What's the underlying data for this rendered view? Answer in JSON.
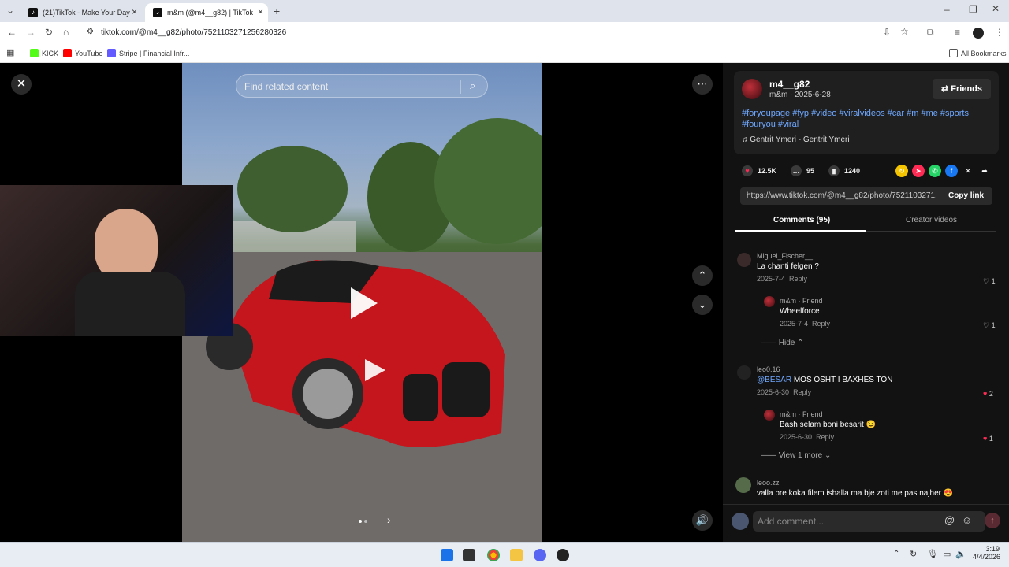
{
  "tabs": [
    {
      "title": "(21)TikTok - Make Your Day"
    },
    {
      "title": "m&m (@m4__g82) | TikTok"
    }
  ],
  "url": "tiktok.com/@m4__g82/photo/7521103271256280326",
  "bookmarks": [
    "KICK",
    "YouTube",
    "Stripe | Financial Infr...",
    "All Bookmarks"
  ],
  "search_placeholder": "Find related content",
  "author": {
    "username": "m4__g82",
    "meta": "m&m · 2025-6-28",
    "follow_button": "Friends",
    "caption": "#foryoupage #fyp #video #viralvideos #car #m #me #sports #fouryou #viral",
    "music": "Gentrit Ymeri - Gentrit Ymeri"
  },
  "stats": {
    "likes": "12.5K",
    "comments": "95",
    "saves": "1240"
  },
  "share_link": "https://www.tiktok.com/@m4__g82/photo/7521103271...",
  "copy_link_label": "Copy link",
  "panel_tabs": [
    "Comments (95)",
    "Creator videos"
  ],
  "comments": [
    {
      "user": "Miguel_Fischer__",
      "text": "La chanti felgen ?",
      "date": "2025-7-4",
      "reply": "Reply",
      "likes": "1"
    },
    {
      "user": "m&m · Friend",
      "text": "Wheelforce",
      "date": "2025-7-4",
      "reply": "Reply",
      "likes": "1"
    },
    {
      "user": "leo0.16",
      "mention": "@BESAR",
      "text": "MOS OSHT I BAXHES TON",
      "date": "2025-6-30",
      "reply": "Reply",
      "likes": "2"
    },
    {
      "user": "m&m · Friend",
      "text": "Bash selam boni besarit 😉",
      "date": "2025-6-30",
      "reply": "Reply",
      "likes": "1"
    },
    {
      "user": "leoo.zz",
      "text": "valla bre koka filem ishalla ma bje zoti me pas najher 😍"
    }
  ],
  "hide_label": "Hide",
  "view_more_label": "View 1 more",
  "add_comment_placeholder": "Add comment...",
  "clock": {
    "time": "3:19",
    "date": "4/4/2026"
  }
}
